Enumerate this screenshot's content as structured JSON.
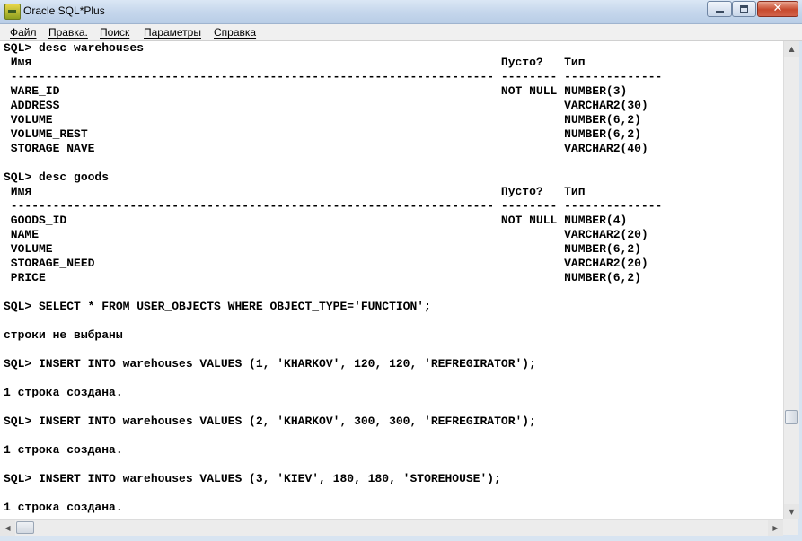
{
  "window": {
    "title": "Oracle SQL*Plus"
  },
  "menu": [
    "Файл",
    "Правка.",
    "Поиск",
    "Параметры",
    "Справка"
  ],
  "console_lines": [
    "SQL> desc warehouses",
    " Имя                                                                   Пусто?   Тип",
    " --------------------------------------------------------------------- -------- --------------",
    " WARE_ID                                                               NOT NULL NUMBER(3)",
    " ADDRESS                                                                        VARCHAR2(30)",
    " VOLUME                                                                         NUMBER(6,2)",
    " VOLUME_REST                                                                    NUMBER(6,2)",
    " STORAGE_NAVE                                                                   VARCHAR2(40)",
    "",
    "SQL> desc goods",
    " Имя                                                                   Пусто?   Тип",
    " --------------------------------------------------------------------- -------- --------------",
    " GOODS_ID                                                              NOT NULL NUMBER(4)",
    " NAME                                                                           VARCHAR2(20)",
    " VOLUME                                                                         NUMBER(6,2)",
    " STORAGE_NEED                                                                   VARCHAR2(20)",
    " PRICE                                                                          NUMBER(6,2)",
    "",
    "SQL> SELECT * FROM USER_OBJECTS WHERE OBJECT_TYPE='FUNCTION';",
    "",
    "строки не выбраны",
    "",
    "SQL> INSERT INTO warehouses VALUES (1, 'KHARKOV', 120, 120, 'REFREGIRATOR');",
    "",
    "1 строка создана.",
    "",
    "SQL> INSERT INTO warehouses VALUES (2, 'KHARKOV', 300, 300, 'REFREGIRATOR');",
    "",
    "1 строка создана.",
    "",
    "SQL> INSERT INTO warehouses VALUES (3, 'KIEV', 180, 180, 'STOREHOUSE');",
    "",
    "1 строка создана."
  ]
}
